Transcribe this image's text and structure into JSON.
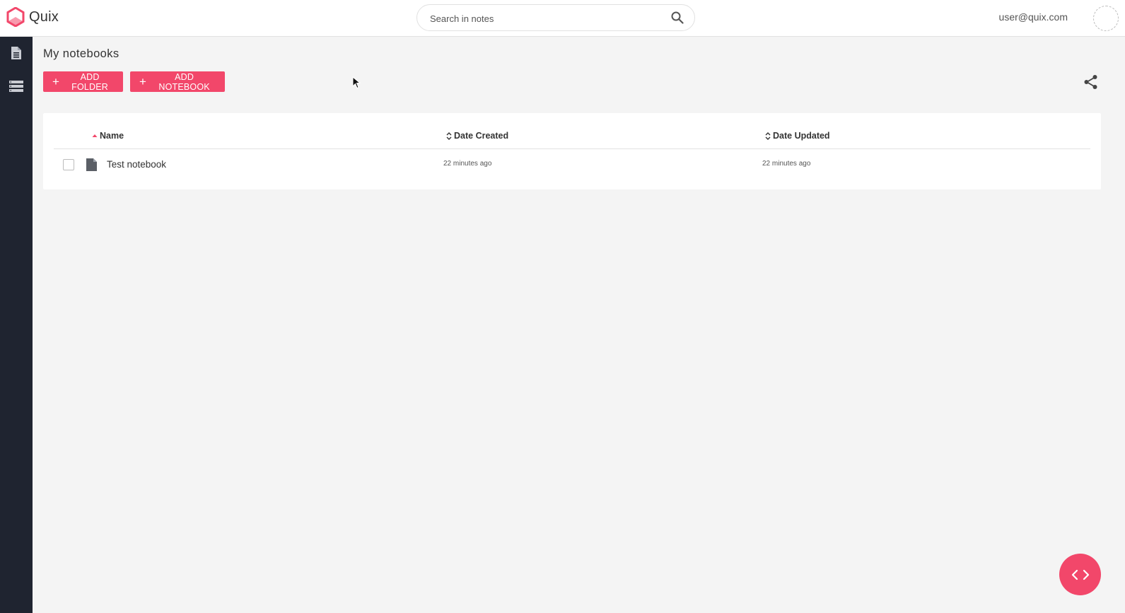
{
  "app": {
    "name": "Quix",
    "brand_color": "#f2476a"
  },
  "header": {
    "search_placeholder": "Search in notes",
    "user_email": "user@quix.com"
  },
  "sidebar": {
    "items": [
      {
        "icon": "document-icon"
      },
      {
        "icon": "database-list-icon"
      }
    ]
  },
  "main": {
    "title": "My notebooks",
    "add_folder_label": "ADD FOLDER",
    "add_notebook_label": "ADD NOTEBOOK"
  },
  "table": {
    "columns": {
      "name": "Name",
      "date_created": "Date Created",
      "date_updated": "Date Updated"
    },
    "sorted_column": "Name",
    "rows": [
      {
        "name": "Test notebook",
        "date_created": "22 minutes ago",
        "date_updated": "22 minutes ago"
      }
    ]
  }
}
